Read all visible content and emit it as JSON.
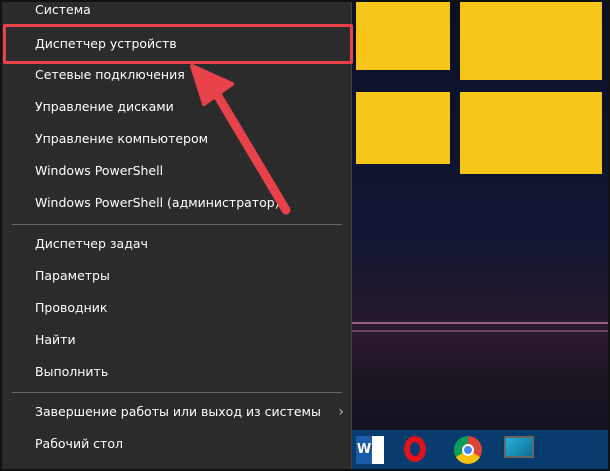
{
  "menu": {
    "items": [
      {
        "label": "Система"
      },
      {
        "label": "Диспетчер устройств"
      },
      {
        "label": "Сетевые подключения"
      },
      {
        "label": "Управление дисками"
      },
      {
        "label": "Управление компьютером"
      },
      {
        "label": "Windows PowerShell"
      },
      {
        "label": "Windows PowerShell (администратор)"
      },
      {
        "label": "Диспетчер задач"
      },
      {
        "label": "Параметры"
      },
      {
        "label": "Проводник"
      },
      {
        "label": "Найти"
      },
      {
        "label": "Выполнить"
      },
      {
        "label": "Завершение работы или выход из системы"
      },
      {
        "label": "Рабочий стол"
      }
    ],
    "highlighted": "Диспетчер устройств"
  },
  "taskbar": {
    "icons": [
      "word-icon",
      "opera-icon",
      "chrome-icon",
      "monitor-icon"
    ],
    "word_letter": "W"
  },
  "colors": {
    "highlight": "#e8414a",
    "menu_bg": "#2b2b2b",
    "taskbar": "#083c6e",
    "tile": "#f5c518"
  }
}
